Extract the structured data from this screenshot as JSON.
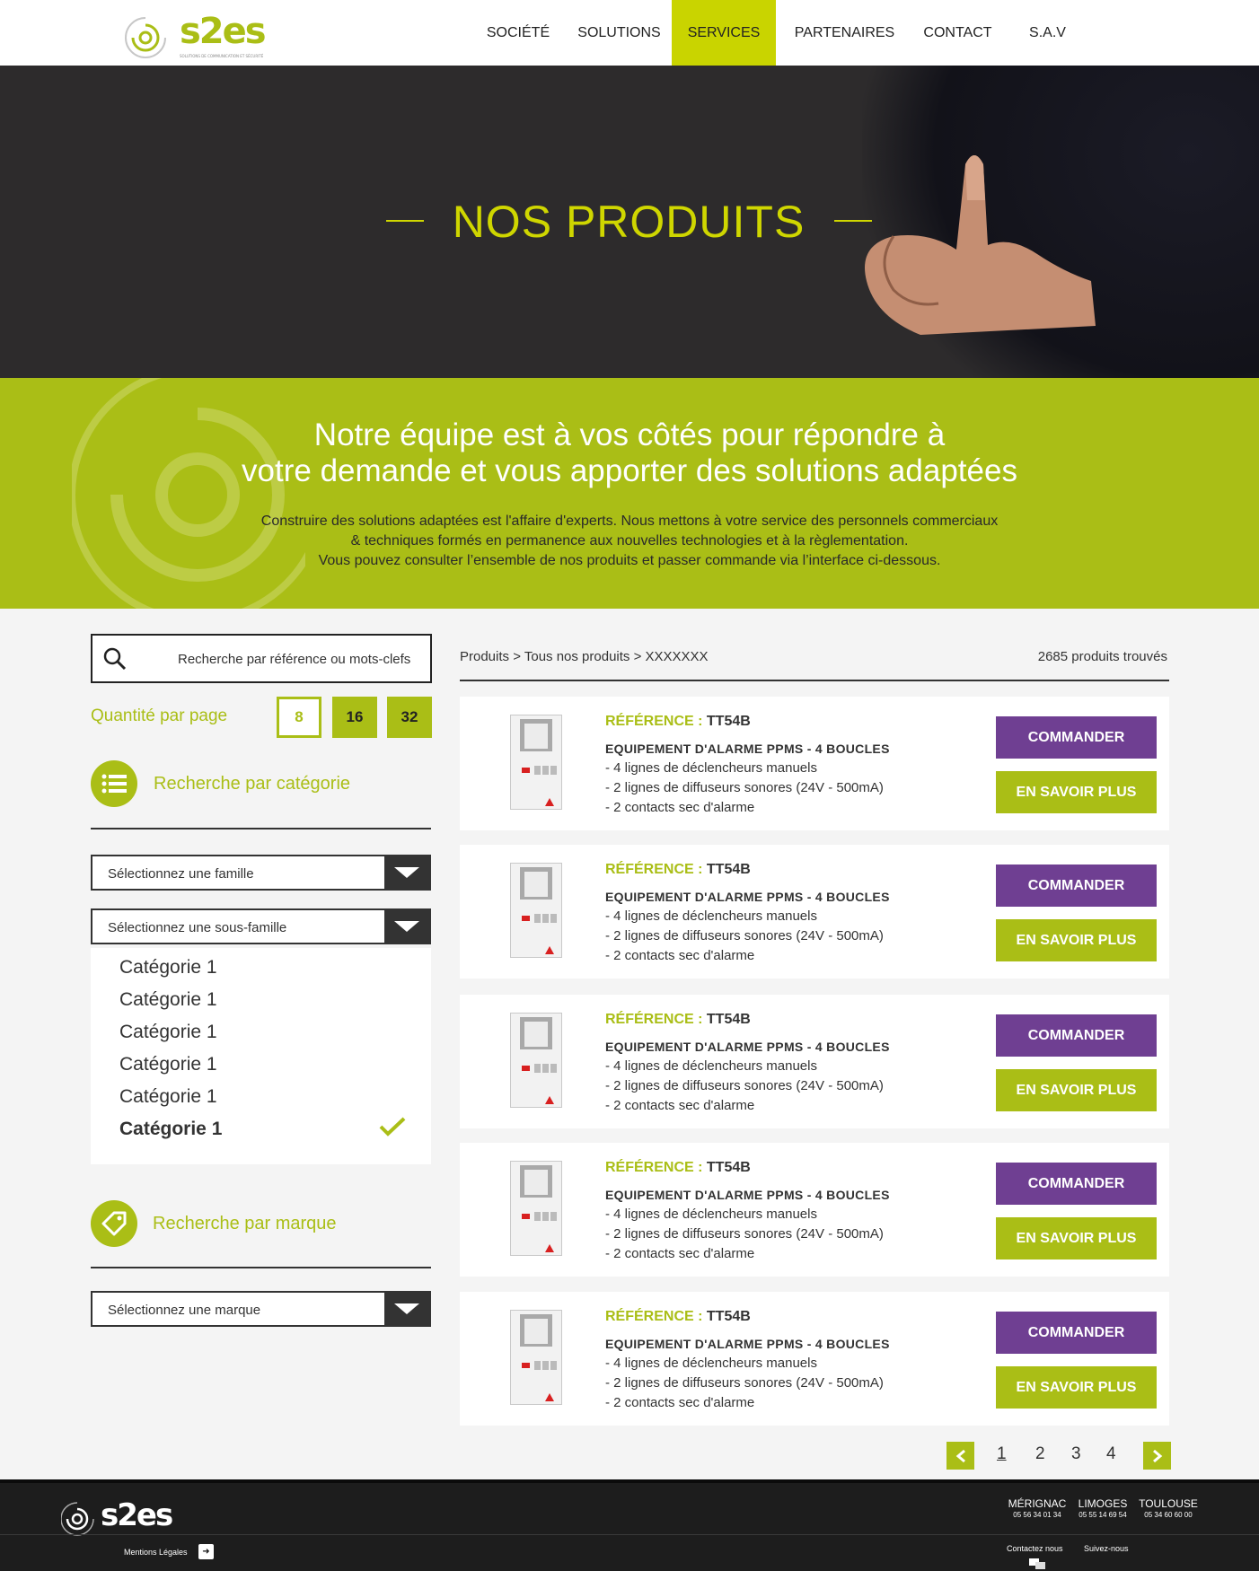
{
  "brand": {
    "logo_text": "s2es",
    "logo_tagline": "SOLUTIONS DE COMMUNICATION ET SÉCURITÉ"
  },
  "nav": [
    {
      "label": "SOCIÉTÉ"
    },
    {
      "label": "SOLUTIONS"
    },
    {
      "label": "SERVICES",
      "active": true
    },
    {
      "label": "PARTENAIRES"
    },
    {
      "label": "CONTACT"
    },
    {
      "label": "S.A.V"
    }
  ],
  "hero": {
    "title": "NOS PRODUITS"
  },
  "intro": {
    "title_line1": "Notre équipe est à vos côtés pour répondre à",
    "title_line2": "votre demande et vous apporter des solutions adaptées",
    "text_line1": "Construire des solutions adaptées est l'affaire d'experts. Nous mettons à votre service des personnels commerciaux",
    "text_line2": "& techniques formés en permanence aux nouvelles technologies et à la règlementation.",
    "text_line3": "Vous pouvez consulter l’ensemble de nos produits et passer commande via l’interface ci-dessous."
  },
  "sidebar": {
    "search_placeholder": "Recherche par référence ou mots-clefs",
    "qty_label": "Quantité par page",
    "qty_options": [
      "8",
      "16",
      "32"
    ],
    "qty_selected": "8",
    "category_title": "Recherche par catégorie",
    "family_select": "Sélectionnez une famille",
    "subfamily_select": "Sélectionnez une sous-famille",
    "categories": [
      "Catégorie 1",
      "Catégorie 1",
      "Catégorie 1",
      "Catégorie 1",
      "Catégorie 1",
      "Catégorie 1"
    ],
    "selected_category_index": 5,
    "brand_title": "Recherche par marque",
    "brand_select": "Sélectionnez une marque"
  },
  "listing": {
    "breadcrumb": "Produits > Tous nos produits > XXXXXXX",
    "count": "2685 produits trouvés",
    "ref_label": "RÉFÉRENCE :",
    "order_label": "COMMANDER",
    "more_label": "EN SAVOIR PLUS",
    "products": [
      {
        "ref": "TT54B",
        "name": "EQUIPEMENT D'ALARME PPMS - 4 BOUCLES",
        "features": [
          "- 4 lignes de déclencheurs manuels",
          "- 2 lignes de diffuseurs sonores (24V - 500mA)",
          "- 2 contacts sec d'alarme"
        ]
      },
      {
        "ref": "TT54B",
        "name": "EQUIPEMENT D'ALARME PPMS - 4 BOUCLES",
        "features": [
          "- 4 lignes de déclencheurs manuels",
          "- 2 lignes de diffuseurs sonores (24V - 500mA)",
          "- 2 contacts sec d'alarme"
        ]
      },
      {
        "ref": "TT54B",
        "name": "EQUIPEMENT D'ALARME PPMS - 4 BOUCLES",
        "features": [
          "- 4 lignes de déclencheurs manuels",
          "- 2 lignes de diffuseurs sonores (24V - 500mA)",
          "- 2 contacts sec d'alarme"
        ]
      },
      {
        "ref": "TT54B",
        "name": "EQUIPEMENT D'ALARME PPMS - 4 BOUCLES",
        "features": [
          "- 4 lignes de déclencheurs manuels",
          "- 2 lignes de diffuseurs sonores (24V - 500mA)",
          "- 2 contacts sec d'alarme"
        ]
      },
      {
        "ref": "TT54B",
        "name": "EQUIPEMENT D'ALARME PPMS - 4 BOUCLES",
        "features": [
          "- 4 lignes de déclencheurs manuels",
          "- 2 lignes de diffuseurs sonores (24V - 500mA)",
          "- 2 contacts sec d'alarme"
        ]
      }
    ],
    "pages": [
      "1",
      "2",
      "3",
      "4"
    ],
    "current_page": "1"
  },
  "footer": {
    "legal": "Mentions Légales",
    "cities": [
      {
        "name": "MÉRIGNAC",
        "phone": "05 56 34 01 34"
      },
      {
        "name": "LIMOGES",
        "phone": "05 55 14 69 54"
      },
      {
        "name": "TOULOUSE",
        "phone": "05 34 60 60 00"
      }
    ],
    "contact": "Contactez nous",
    "follow": "Suivez-nous"
  },
  "colors": {
    "accent": "#aabe16",
    "nav_active": "#c9d400",
    "order": "#6f3f92",
    "dark": "#2d2b2c"
  }
}
